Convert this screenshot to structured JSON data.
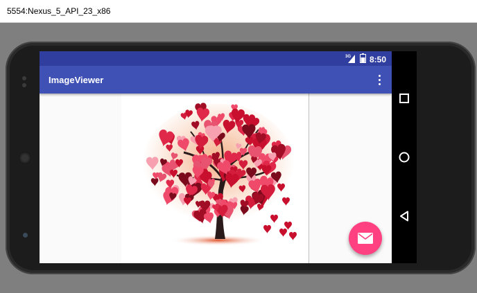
{
  "window": {
    "title": "5554:Nexus_5_API_23_x86"
  },
  "statusbar": {
    "network": "3G",
    "time": "8:50"
  },
  "appbar": {
    "title": "ImageViewer",
    "overflow_icon": "more-vert-icon"
  },
  "content": {
    "image_subject": "tree-of-hearts"
  },
  "fab": {
    "icon": "email-icon",
    "color": "#ff4081"
  },
  "navbar": {
    "icons": [
      "recents-icon",
      "home-icon",
      "back-icon"
    ]
  },
  "colors": {
    "primary": "#3f51b5",
    "primary_dark": "#303f9f",
    "accent": "#ff4081"
  }
}
